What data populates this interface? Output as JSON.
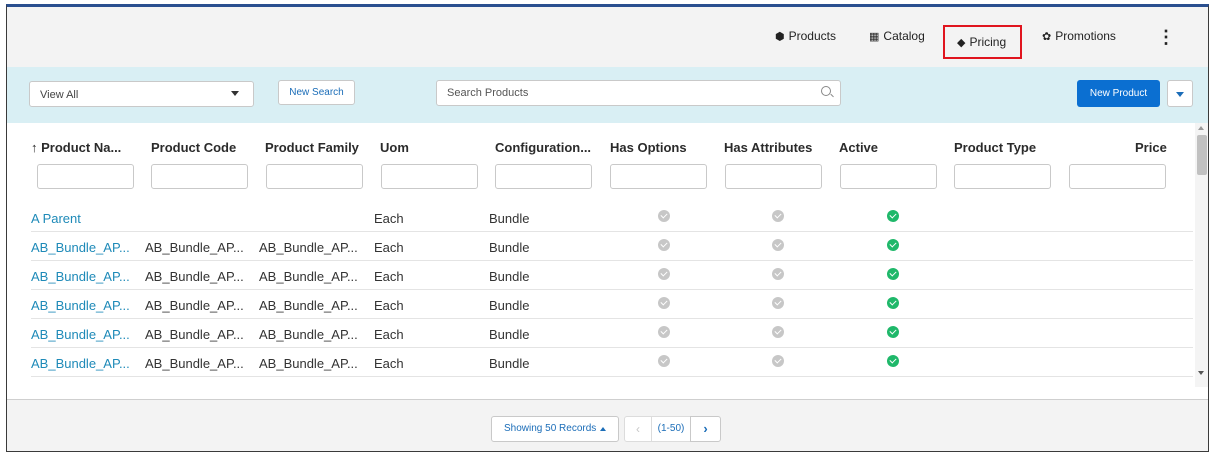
{
  "nav": {
    "products": {
      "icon": "box-icon",
      "glyph": "⬢",
      "label": "Products"
    },
    "catalog": {
      "icon": "grid-icon",
      "glyph": "▦",
      "label": "Catalog"
    },
    "pricing": {
      "icon": "tag-icon",
      "glyph": "◆",
      "label": "Pricing",
      "highlight_color": "#e0141e"
    },
    "promotions": {
      "icon": "gift-icon",
      "glyph": "✿",
      "label": "Promotions"
    },
    "more": "⋮"
  },
  "filterbar": {
    "view_select": "View All",
    "new_search": "New Search",
    "search_placeholder": "Search Products",
    "new_product": "New Product"
  },
  "table": {
    "columns": [
      "↑ Product Na...",
      "Product Code",
      "Product Family",
      "Uom",
      "Configuration...",
      "Has Options",
      "Has Attributes",
      "Active",
      "Product Type",
      "Price"
    ],
    "rows": [
      {
        "name": "A Parent",
        "code": "",
        "family": "",
        "uom": "Each",
        "config": "Bundle",
        "has_options": false,
        "has_attributes": false,
        "active": true,
        "type": "",
        "price": ""
      },
      {
        "name": "AB_Bundle_AP...",
        "code": "AB_Bundle_AP...",
        "family": "AB_Bundle_AP...",
        "uom": "Each",
        "config": "Bundle",
        "has_options": false,
        "has_attributes": false,
        "active": true,
        "type": "",
        "price": ""
      },
      {
        "name": "AB_Bundle_AP...",
        "code": "AB_Bundle_AP...",
        "family": "AB_Bundle_AP...",
        "uom": "Each",
        "config": "Bundle",
        "has_options": false,
        "has_attributes": false,
        "active": true,
        "type": "",
        "price": ""
      },
      {
        "name": "AB_Bundle_AP...",
        "code": "AB_Bundle_AP...",
        "family": "AB_Bundle_AP...",
        "uom": "Each",
        "config": "Bundle",
        "has_options": false,
        "has_attributes": false,
        "active": true,
        "type": "",
        "price": ""
      },
      {
        "name": "AB_Bundle_AP...",
        "code": "AB_Bundle_AP...",
        "family": "AB_Bundle_AP...",
        "uom": "Each",
        "config": "Bundle",
        "has_options": false,
        "has_attributes": false,
        "active": true,
        "type": "",
        "price": ""
      },
      {
        "name": "AB_Bundle_AP...",
        "code": "AB_Bundle_AP...",
        "family": "AB_Bundle_AP...",
        "uom": "Each",
        "config": "Bundle",
        "has_options": false,
        "has_attributes": false,
        "active": true,
        "type": "",
        "price": ""
      }
    ]
  },
  "footer": {
    "records_label": "Showing 50 Records",
    "range_label": "(1-50)",
    "prev_glyph": "‹",
    "next_glyph": "›"
  },
  "colors": {
    "accent": "#0b6fd1",
    "link": "#1e8ab8",
    "filter_bar_bg": "#d9eff4",
    "active_green": "#1fb86a",
    "inactive_grey": "#c7c7c7"
  }
}
